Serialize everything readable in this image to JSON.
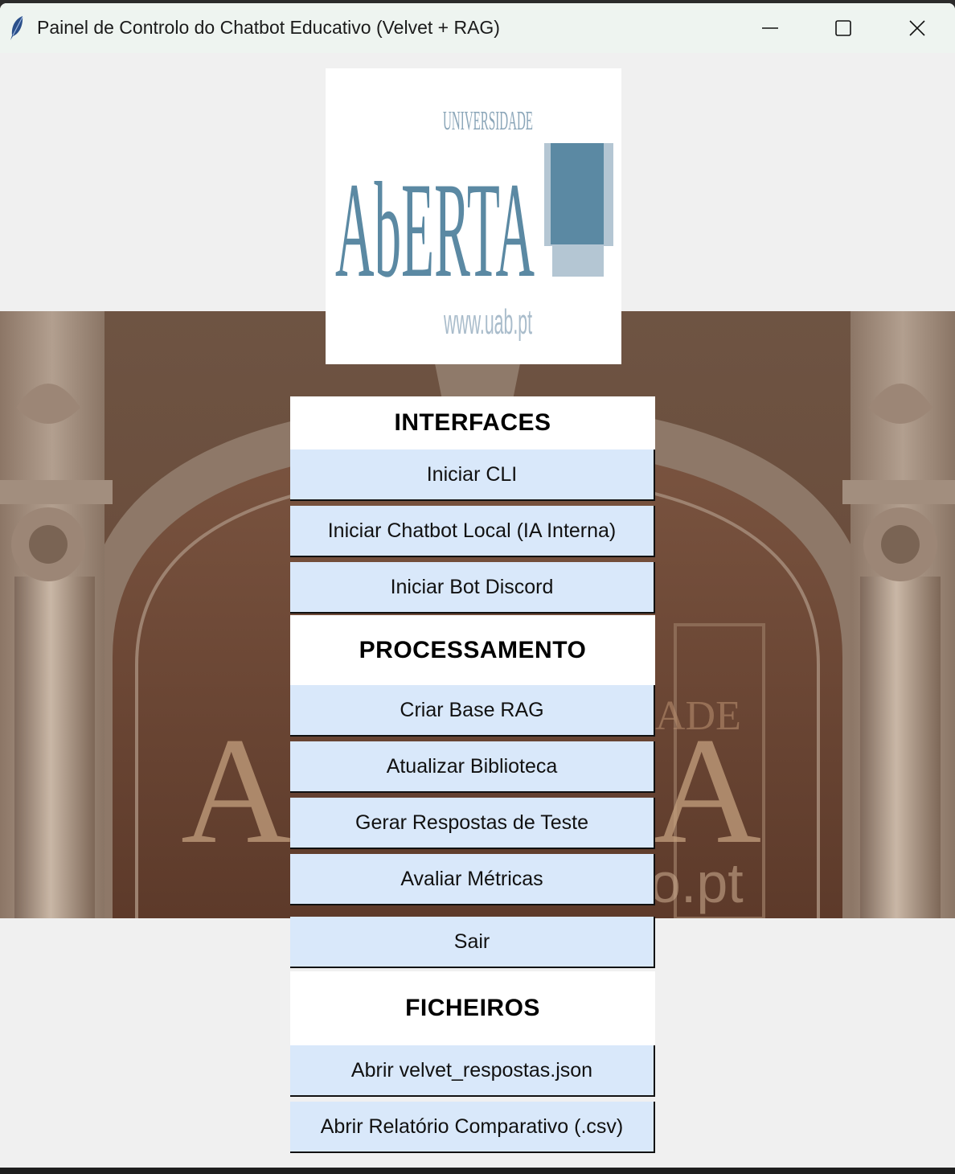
{
  "window": {
    "title": "Painel de Controlo do Chatbot Educativo (Velvet + RAG)",
    "controls": {
      "minimize": "minimize-icon",
      "maximize": "maximize-icon",
      "close": "close-icon"
    }
  },
  "logo": {
    "brand_colors": {
      "primary": "#5b89a3",
      "light": "#b4c6d3"
    }
  },
  "sections": {
    "interfaces": {
      "heading": "INTERFACES",
      "buttons": [
        "Iniciar CLI",
        "Iniciar Chatbot Local (IA Interna)",
        "Iniciar Bot Discord"
      ]
    },
    "processamento": {
      "heading": "PROCESSAMENTO",
      "buttons": [
        "Criar Base RAG",
        "Atualizar Biblioteca",
        "Gerar Respostas de Teste",
        "Avaliar Métricas"
      ]
    },
    "exit": {
      "label": "Sair"
    },
    "ficheiros": {
      "heading": "FICHEIROS",
      "buttons": [
        "Abrir velvet_respostas.json",
        "Abrir Relatório Comparativo (.csv)"
      ]
    }
  },
  "colors": {
    "button_bg": "#d9e8fa",
    "heading_bg": "#ffffff",
    "window_bg": "#f0f0f0"
  }
}
